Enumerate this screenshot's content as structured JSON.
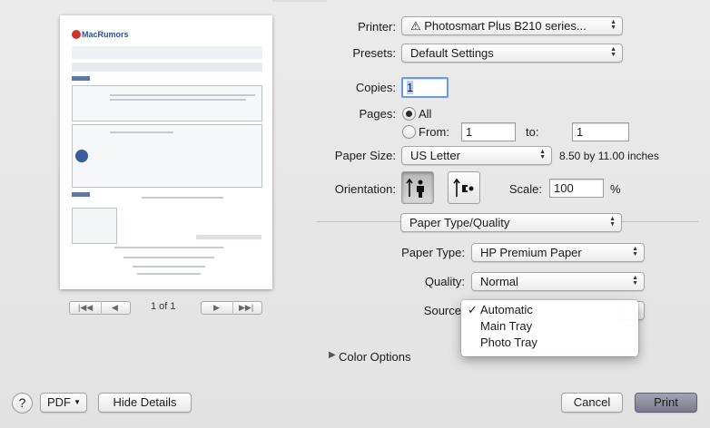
{
  "printer": {
    "label": "Printer:",
    "value": "⚠ Photosmart Plus B210 series..."
  },
  "presets": {
    "label": "Presets:",
    "value": "Default Settings"
  },
  "copies": {
    "label": "Copies:",
    "value": "1"
  },
  "pages": {
    "label": "Pages:",
    "all_label": "All",
    "from_label": "From:",
    "from_value": "1",
    "to_label": "to:",
    "to_value": "1",
    "selected": "All"
  },
  "paper_size": {
    "label": "Paper Size:",
    "value": "US Letter",
    "dimensions": "8.50 by 11.00 inches"
  },
  "orientation": {
    "label": "Orientation:",
    "selected": "portrait"
  },
  "scale": {
    "label": "Scale:",
    "value": "100",
    "unit": "%"
  },
  "section": {
    "value": "Paper Type/Quality"
  },
  "paper_type": {
    "label": "Paper Type:",
    "value": "HP Premium Paper"
  },
  "quality": {
    "label": "Quality:",
    "value": "Normal"
  },
  "source": {
    "label": "Source",
    "options": [
      "Automatic",
      "Main Tray",
      "Photo Tray"
    ],
    "checked_mark": "✓",
    "selected": "Automatic"
  },
  "color_options": {
    "label": "Color Options"
  },
  "preview_nav": {
    "page_indicator": "1 of 1",
    "first": "|◀◀",
    "prev": "◀",
    "next": "▶",
    "last": "▶▶|"
  },
  "preview_page": {
    "logo_text": "MacRumors"
  },
  "footer": {
    "help": "?",
    "pdf": "PDF",
    "hide_details": "Hide Details",
    "cancel": "Cancel",
    "print": "Print"
  },
  "icons": {
    "help": "help-icon",
    "dropdown": "chevron-down-icon",
    "portrait": "portrait-orientation-icon",
    "landscape": "landscape-orientation-icon",
    "disclosure": "disclosure-triangle-icon"
  },
  "colors": {
    "accent": "#6f6f7f",
    "sheet_background": "#e6e6e6"
  }
}
